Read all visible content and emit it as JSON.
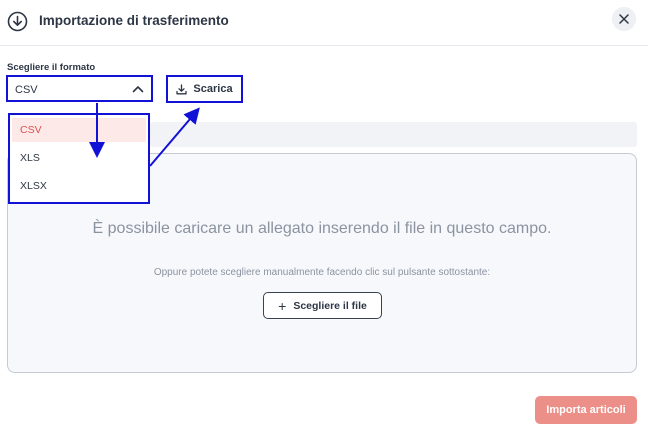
{
  "header": {
    "title": "Importazione di trasferimento",
    "icon": "download-circle-icon",
    "close_icon": "close-icon"
  },
  "format": {
    "label": "Scegliere il formato",
    "selected": "CSV",
    "options": [
      "CSV",
      "XLS",
      "XLSX"
    ]
  },
  "download": {
    "label": "Scarica",
    "icon": "download-icon"
  },
  "dropzone": {
    "main_text": "È possibile caricare un allegato inserendo il file in questo campo.",
    "sub_text": "Oppure potete scegliere manualmente facendo clic sul pulsante sottostante:",
    "choose_label": "Scegliere il file"
  },
  "footer": {
    "import_label": "Importa articoli"
  },
  "colors": {
    "annotation": "#1212d6",
    "accent": "#ec8f88",
    "selected_option_text": "#d9534f",
    "selected_option_bg": "#fde9e8"
  }
}
